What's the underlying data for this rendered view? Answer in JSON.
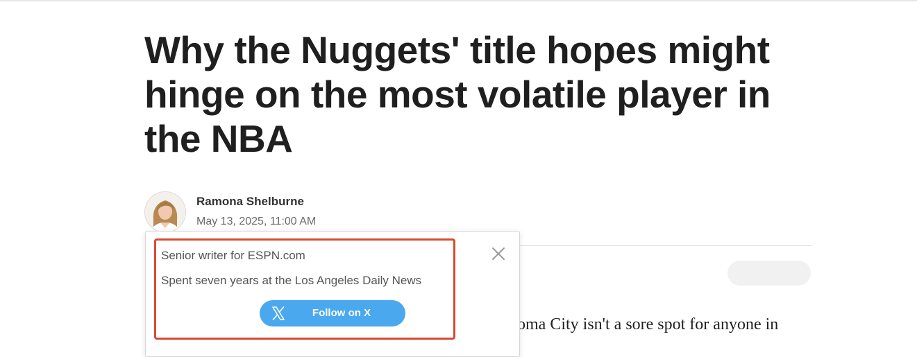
{
  "article": {
    "headline": "Why the Nuggets' title hopes might hinge on the most volatile player in the NBA",
    "body_preview": "oma City isn't a sore spot for anyone in"
  },
  "byline": {
    "author_name": "Ramona Shelburne",
    "date": "May 13, 2025, 11:00 AM"
  },
  "author_popover": {
    "bio_line_1": "Senior writer for ESPN.com",
    "bio_line_2": "Spent seven years at the Los Angeles Daily News",
    "follow_label": "Follow on X",
    "close_icon": "close-icon",
    "x_icon": "x-logo-icon"
  },
  "colors": {
    "follow_button": "#4aa8ee",
    "highlight_border": "#d84a30"
  }
}
